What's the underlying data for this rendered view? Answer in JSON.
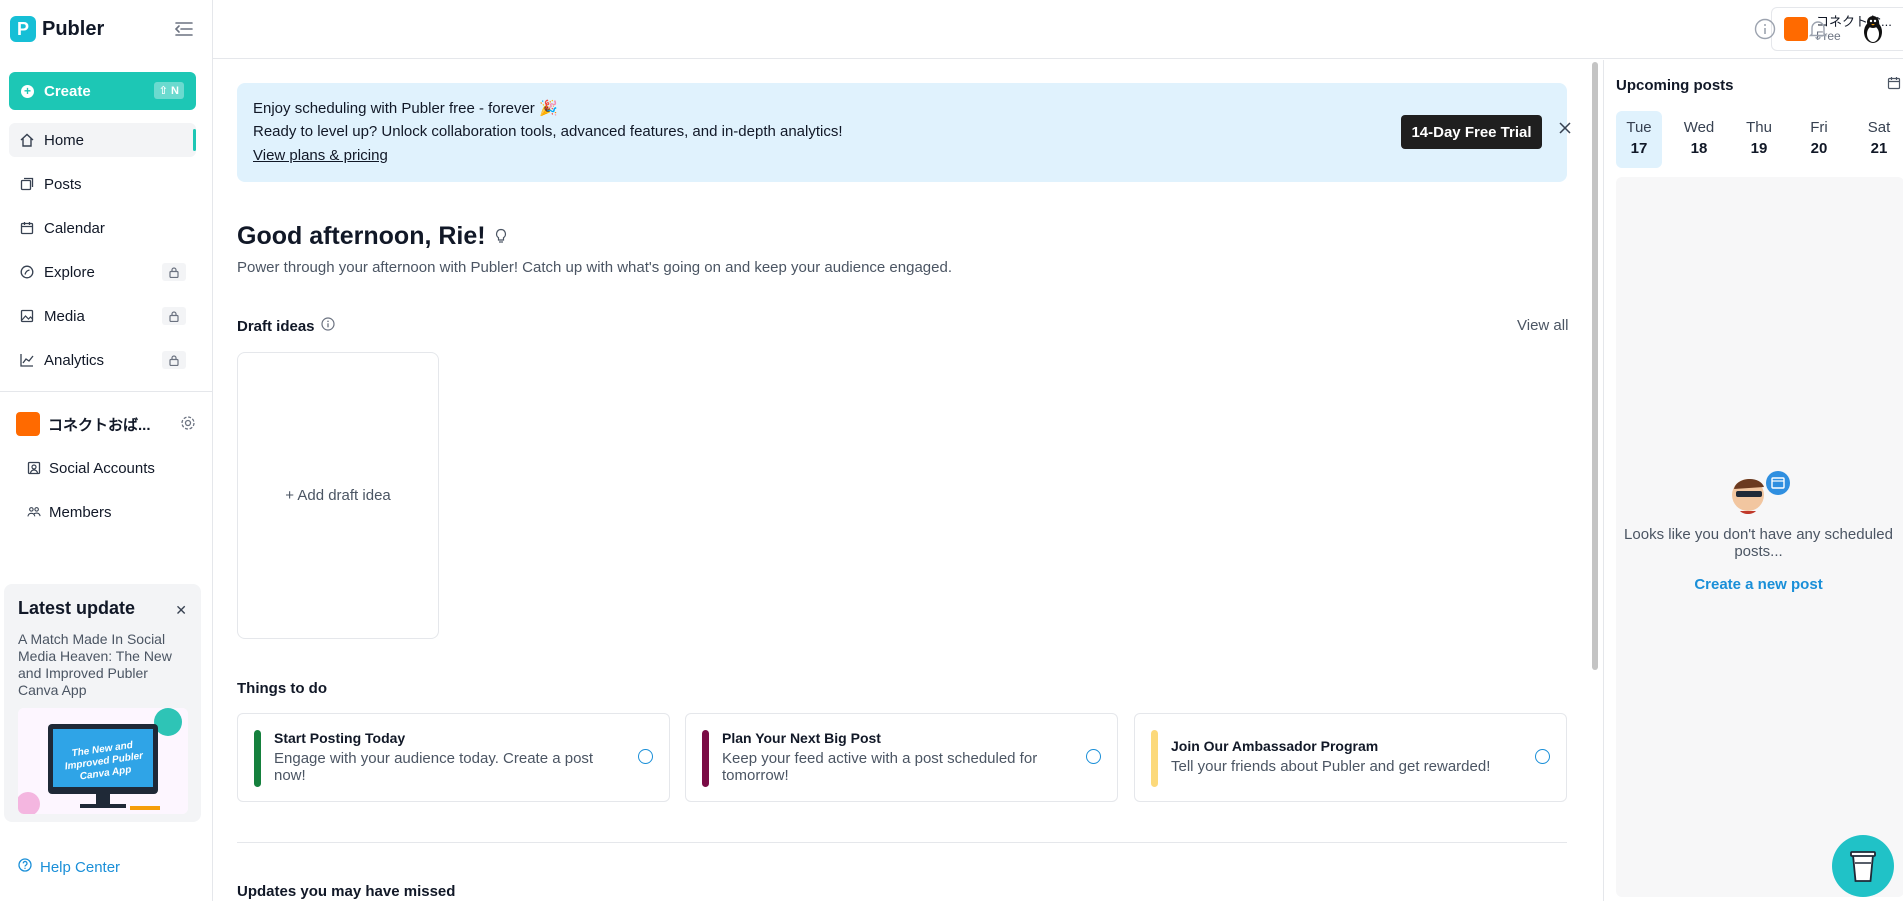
{
  "brand": {
    "name": "Publer",
    "logo_letter": "P"
  },
  "sidebar": {
    "create_label": "Create",
    "create_shortcut": "⇧ N",
    "items": [
      {
        "label": "Home"
      },
      {
        "label": "Posts"
      },
      {
        "label": "Calendar"
      },
      {
        "label": "Explore"
      },
      {
        "label": "Media"
      },
      {
        "label": "Analytics"
      }
    ],
    "workspace_name": "コネクトおば...",
    "workspace_items": [
      {
        "label": "Social Accounts"
      },
      {
        "label": "Members"
      }
    ],
    "latest_update": {
      "title": "Latest update",
      "description": "A Match Made In Social Media Heaven: The New and Improved Publer Canva App",
      "image_text": "The New and Improved Publer Canva App"
    },
    "help_label": "Help Center"
  },
  "topbar": {
    "account_name": "コネクトお...",
    "account_plan": "Free"
  },
  "banner": {
    "line1": "Enjoy scheduling with Publer free - forever 🎉",
    "line2": "Ready to level up? Unlock collaboration tools, advanced features, and in-depth analytics!",
    "link": "View plans & pricing",
    "trial_button": "14-Day Free Trial"
  },
  "greeting": {
    "title": "Good afternoon, Rie!",
    "subtitle": "Power through your afternoon with Publer! Catch up with what's going on and keep your audience engaged."
  },
  "drafts": {
    "heading": "Draft ideas",
    "view_all": "View all",
    "add_label": "+ Add draft idea"
  },
  "todo": {
    "heading": "Things to do",
    "items": [
      {
        "title": "Start Posting Today",
        "desc": "Engage with your audience today. Create a post now!",
        "color": "#15803d"
      },
      {
        "title": "Plan Your Next Big Post",
        "desc": "Keep your feed active with a post scheduled for tomorrow!",
        "color": "#7a0b45"
      },
      {
        "title": "Join Our Ambassador Program",
        "desc": "Tell your friends about Publer and get rewarded!",
        "color": "#fcd97a"
      }
    ]
  },
  "updates_heading": "Updates you may have missed",
  "upcoming": {
    "title": "Upcoming posts",
    "days": [
      {
        "name": "Tue",
        "num": "17"
      },
      {
        "name": "Wed",
        "num": "18"
      },
      {
        "name": "Thu",
        "num": "19"
      },
      {
        "name": "Fri",
        "num": "20"
      },
      {
        "name": "Sat",
        "num": "21"
      }
    ],
    "empty_text": "Looks like you don't have any scheduled posts...",
    "empty_link": "Create a new post"
  },
  "colors": {
    "accent": "#1dc7b5",
    "link": "#1a8fd8",
    "workspace": "#ff6a00"
  }
}
